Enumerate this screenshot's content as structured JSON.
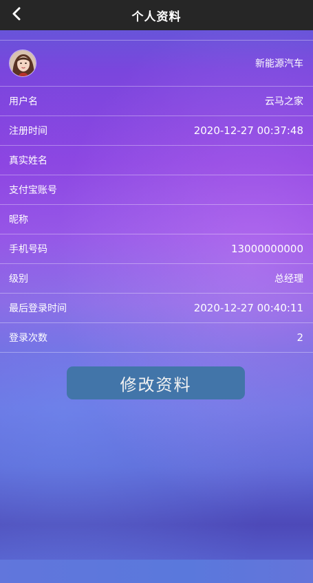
{
  "header": {
    "title": "个人资料",
    "back_icon": "chevron-left-icon"
  },
  "profile": {
    "avatar_icon": "user-avatar",
    "avatar_value": "新能源汽车",
    "rows": [
      {
        "label": "用户名",
        "value": "云马之家"
      },
      {
        "label": "注册时间",
        "value": "2020-12-27 00:37:48"
      },
      {
        "label": "真实姓名",
        "value": ""
      },
      {
        "label": "支付宝账号",
        "value": ""
      },
      {
        "label": "昵称",
        "value": ""
      },
      {
        "label": "手机号码",
        "value": "13000000000"
      },
      {
        "label": "级别",
        "value": "总经理"
      },
      {
        "label": "最后登录时间",
        "value": "2020-12-27 00:40:11"
      },
      {
        "label": "登录次数",
        "value": "2"
      }
    ]
  },
  "actions": {
    "edit_label": "修改资料"
  },
  "colors": {
    "topbar": "#262626",
    "button": "#4275a9"
  }
}
